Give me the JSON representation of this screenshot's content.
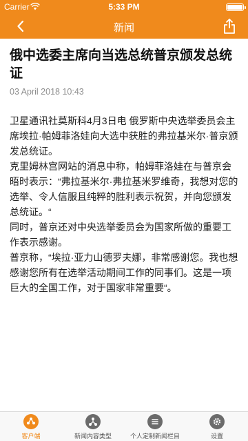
{
  "status_bar": {
    "carrier": "Carrier",
    "time": "5:33 PM"
  },
  "nav": {
    "title": "新闻",
    "back_icon": "chevron-left-icon",
    "share_icon": "share-icon"
  },
  "article": {
    "headline": "俄中选委主席向当选总统普京颁发总统证",
    "date": "03 April 2018 10:43",
    "paragraphs": [
      "卫星通讯社莫斯科4月3日电 俄罗斯中央选举委员会主席埃拉·帕姆菲洛娃向大选中获胜的弗拉基米尔·普京颁发总统证。",
      "克里姆林宫网站的消息中称，帕姆菲洛娃在与普京会晤时表示：“弗拉基米尔·弗拉基米罗维奇，我想对您的选举、令人信服且纯粹的胜利表示祝贺，并向您颁发总统证。“",
      "同时，普京还对中央选举委员会为国家所做的重要工作表示感谢。",
      "普京称，“埃拉·亚力山德罗夫娜，非常感谢您。我也想感谢您所有在选举活动期间工作的同事们。这是一项巨大的全国工作，对于国家非常重要“。"
    ]
  },
  "tabs": [
    {
      "label": "客户端",
      "icon": "share-nodes-icon",
      "active": true
    },
    {
      "label": "新闻内容类型",
      "icon": "network-icon",
      "active": false
    },
    {
      "label": "个人定制新闻栏目",
      "icon": "list-icon",
      "active": false
    },
    {
      "label": "设置",
      "icon": "gear-icon",
      "active": false
    }
  ],
  "colors": {
    "accent": "#f08a1c"
  }
}
